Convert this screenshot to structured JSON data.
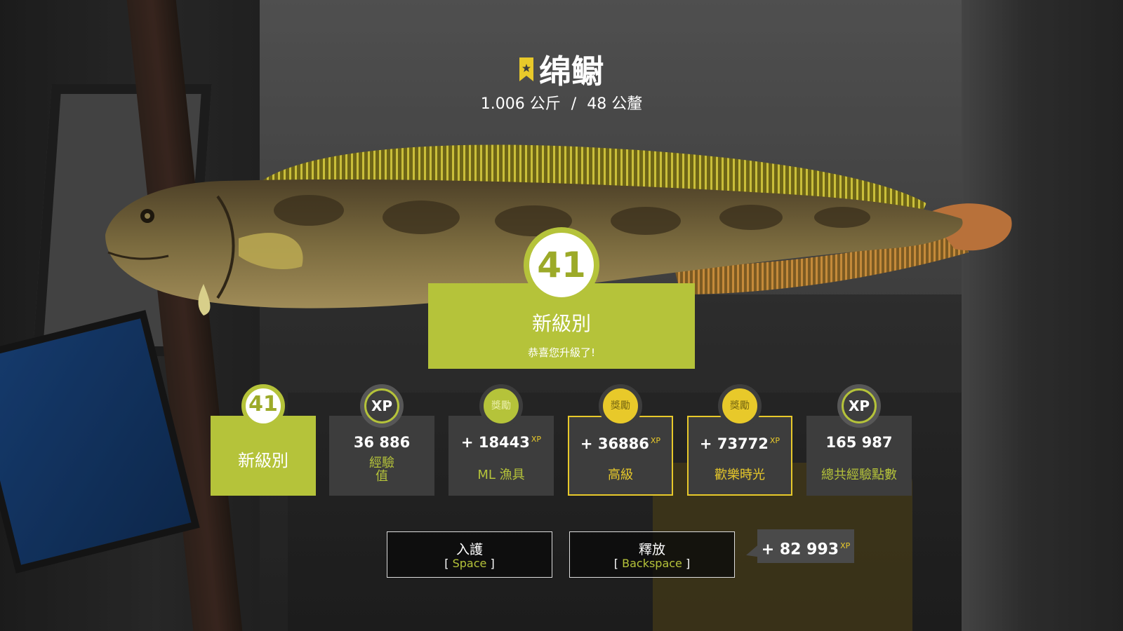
{
  "fish": {
    "name": "绵鳚",
    "weight": "1.006 公斤",
    "separator": "/",
    "length": "48 公釐",
    "icon": "trophy-bookmark-icon"
  },
  "level_up": {
    "level": "41",
    "label": "新級別",
    "congrats": "恭喜您升級了!"
  },
  "cards": [
    {
      "badge": "41",
      "label": "新級別",
      "style": "green"
    },
    {
      "badge": "XP",
      "value": "36 886",
      "label": "經驗\n值"
    },
    {
      "badge": "獎勵",
      "value": "+ 18443",
      "unit": "XP",
      "label": "ML 漁具"
    },
    {
      "badge": "獎勵",
      "value": "+ 36886",
      "unit": "XP",
      "label": "高級",
      "style": "gold"
    },
    {
      "badge": "獎勵",
      "value": "+ 73772",
      "unit": "XP",
      "label": "歡樂時光",
      "style": "gold"
    },
    {
      "badge": "XP",
      "value": "165 987",
      "label": "總共經驗點數"
    }
  ],
  "actions": {
    "keep": {
      "label": "入護",
      "key_open": "[",
      "key": "Space",
      "key_close": "]"
    },
    "release": {
      "label": "釋放",
      "key_open": "[",
      "key": "Backspace",
      "key_close": "]"
    }
  },
  "bonus": {
    "value": "+ 82 993",
    "unit": "XP"
  },
  "colors": {
    "accent": "#b5c33a",
    "gold": "#e8c92a",
    "card": "#3d3d3d"
  }
}
